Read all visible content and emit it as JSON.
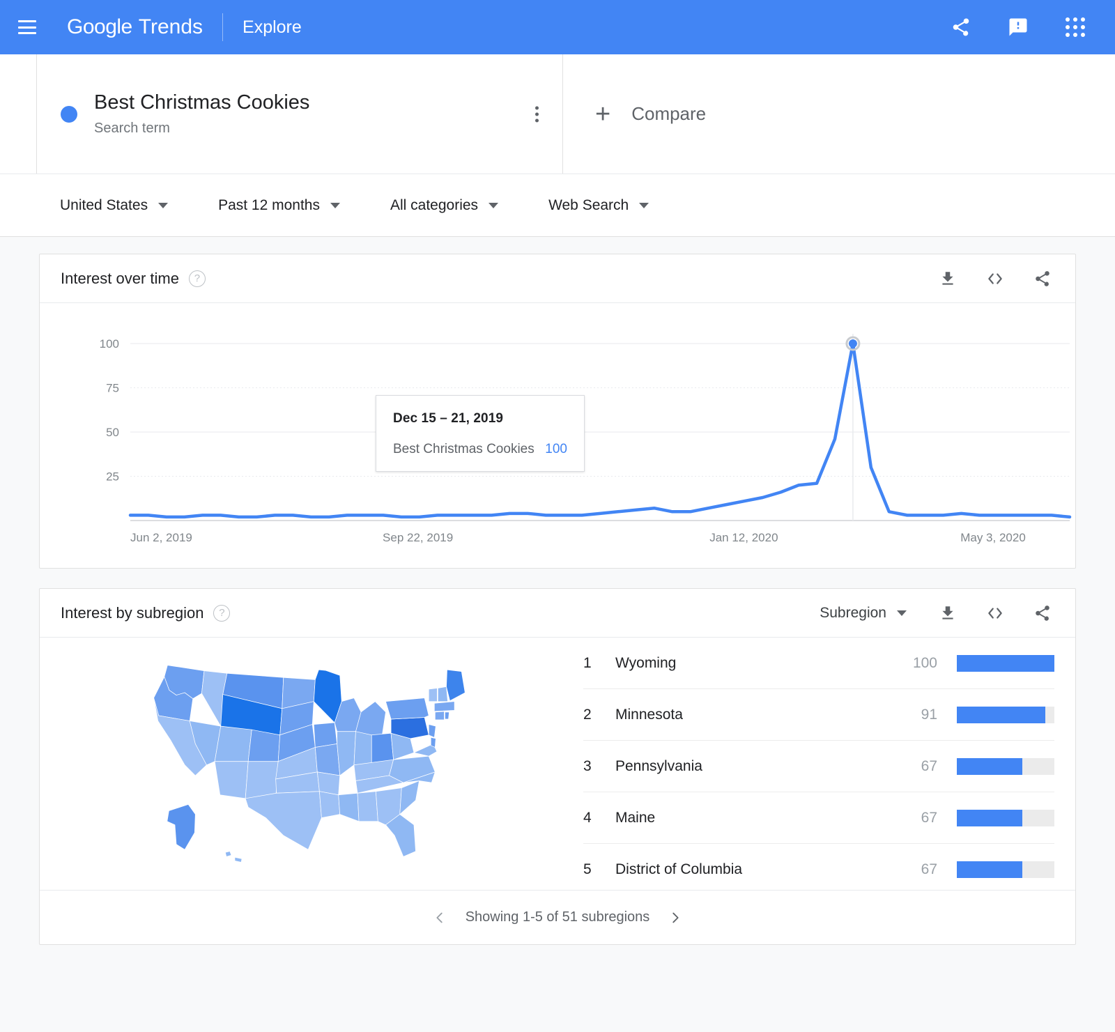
{
  "appbar": {
    "menu_icon": "hamburger-menu-icon",
    "brand_google": "Google",
    "brand_product": "Trends",
    "section": "Explore",
    "share_icon": "share-icon",
    "feedback_icon": "feedback-icon",
    "apps_icon": "google-apps-icon"
  },
  "term": {
    "name": "Best Christmas Cookies",
    "type": "Search term",
    "color": "#4285f4",
    "menu_icon": "more-options-icon"
  },
  "compare": {
    "plus": "+",
    "label": "Compare"
  },
  "filters": [
    {
      "label": "United States",
      "name": "location-filter"
    },
    {
      "label": "Past 12 months",
      "name": "time-range-filter"
    },
    {
      "label": "All categories",
      "name": "category-filter"
    },
    {
      "label": "Web Search",
      "name": "search-type-filter"
    }
  ],
  "interest_over_time": {
    "title": "Interest over time",
    "help_icon": "help-icon",
    "download_icon": "download-icon",
    "embed_icon": "embed-code-icon",
    "share_icon": "share-icon",
    "tooltip": {
      "date": "Dec 15 – 21, 2019",
      "series": "Best Christmas Cookies",
      "value": "100"
    }
  },
  "interest_by_subregion": {
    "title": "Interest by subregion",
    "help_icon": "help-icon",
    "select_label": "Subregion",
    "download_icon": "download-icon",
    "embed_icon": "embed-code-icon",
    "share_icon": "share-icon",
    "rows": [
      {
        "rank": "1",
        "name": "Wyoming",
        "value": "100",
        "pct": 100
      },
      {
        "rank": "2",
        "name": "Minnesota",
        "value": "91",
        "pct": 91
      },
      {
        "rank": "3",
        "name": "Pennsylvania",
        "value": "67",
        "pct": 67
      },
      {
        "rank": "4",
        "name": "Maine",
        "value": "67",
        "pct": 67
      },
      {
        "rank": "5",
        "name": "District of Columbia",
        "value": "67",
        "pct": 67
      }
    ],
    "pager": {
      "prev_icon": "chevron-left-icon",
      "next_icon": "chevron-right-icon",
      "label": "Showing 1-5 of 51 subregions"
    }
  },
  "chart_data": {
    "type": "line",
    "title": "Interest over time",
    "xlabel": "",
    "ylabel": "",
    "ylim": [
      0,
      100
    ],
    "ygrid": [
      25,
      50,
      75,
      100
    ],
    "ytick_labels": [
      "25",
      "50",
      "75",
      "100"
    ],
    "xtick_labels": [
      "Jun 2, 2019",
      "Sep 22, 2019",
      "Jan 12, 2020",
      "May 3, 2020"
    ],
    "xtick_positions": [
      0,
      0.3061,
      0.6531,
      0.9184
    ],
    "series": [
      {
        "name": "Best Christmas Cookies",
        "color": "#4285f4",
        "values": [
          3,
          3,
          2,
          2,
          3,
          3,
          2,
          2,
          3,
          3,
          2,
          2,
          3,
          3,
          3,
          2,
          2,
          3,
          3,
          3,
          3,
          4,
          4,
          3,
          3,
          3,
          4,
          5,
          6,
          7,
          5,
          5,
          7,
          9,
          11,
          13,
          16,
          20,
          21,
          46,
          100,
          30,
          5,
          3,
          3,
          3,
          4,
          3,
          3,
          3,
          3,
          3,
          2
        ],
        "highlight_index": 40,
        "highlight_value": 100
      }
    ],
    "grid": true,
    "legend": "none",
    "map": {
      "type": "choropleth",
      "region": "United States",
      "top_states": [
        "Wyoming",
        "Minnesota",
        "Pennsylvania",
        "Maine",
        "District of Columbia"
      ],
      "scale_color": "#4285f4"
    }
  }
}
